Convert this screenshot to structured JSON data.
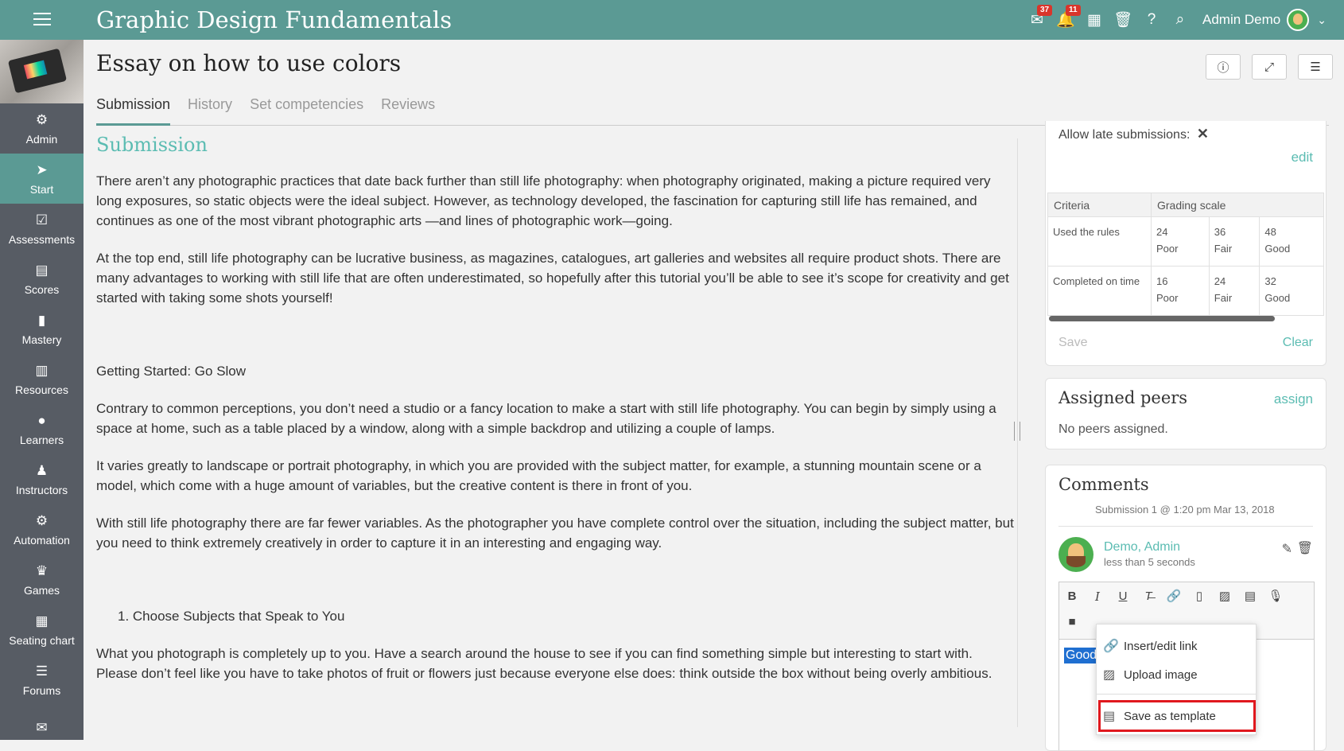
{
  "topbar": {
    "course_title": "Graphic Design Fundamentals",
    "badges": {
      "messages": "37",
      "notifications": "11"
    },
    "user_name": "Admin Demo"
  },
  "sidebar": {
    "items": [
      {
        "label": "Admin",
        "icon": "gear-icon"
      },
      {
        "label": "Start",
        "icon": "navigation-arrow-icon"
      },
      {
        "label": "Assessments",
        "icon": "check-square-icon"
      },
      {
        "label": "Scores",
        "icon": "table-icon"
      },
      {
        "label": "Mastery",
        "icon": "bar-chart-icon"
      },
      {
        "label": "Resources",
        "icon": "books-icon"
      },
      {
        "label": "Learners",
        "icon": "person-icon"
      },
      {
        "label": "Instructors",
        "icon": "instructor-icon"
      },
      {
        "label": "Automation",
        "icon": "gears-icon"
      },
      {
        "label": "Games",
        "icon": "trophy-icon"
      },
      {
        "label": "Seating chart",
        "icon": "seating-grid-icon"
      },
      {
        "label": "Forums",
        "icon": "list-icon"
      }
    ]
  },
  "page": {
    "title": "Essay on how to use colors",
    "tabs": [
      "Submission",
      "History",
      "Set competencies",
      "Reviews"
    ]
  },
  "submission": {
    "heading": "Submission",
    "para1": "There aren’t any photographic practices that date back further than still life photography: when photography originated, making a picture required very long exposures, so static objects were the ideal subject. However, as technology developed, the fascination for capturing still life has remained, and continues as one of the most vibrant photographic arts —and lines of photographic work—going.",
    "para2": "At the top end, still life photography can be lucrative business, as magazines, catalogues, art galleries and websites all require product shots. There are many advantages to working with still life that are often underestimated, so hopefully after this tutorial you’ll be able to see it’s scope for creativity and get started with taking some shots yourself!",
    "subheading": "Getting Started: Go Slow",
    "para3": "Contrary to common perceptions, you don’t need a studio or a fancy location to make a start with still life photography. You can begin by simply using a space at home, such as a table placed by a window, along with a simple backdrop and utilizing a couple of lamps.",
    "para4": "It varies greatly to landscape or portrait photography, in which you are provided with the subject matter, for example, a stunning mountain scene or a model, which come with a huge amount of variables, but the creative content is there in front of you.",
    "para5": "With still life photography there are far fewer variables. As the photographer you have complete control over the situation, including the subject matter, but you need to think extremely creatively in order to capture it in an interesting and engaging way.",
    "list_item": "1. Choose Subjects that Speak to You",
    "para6": "What you photograph is completely up to you. Have a search around the house to see if you can find something simple but interesting to start with. Please don’t feel like you have to take photos of fruit or flowers just because everyone else does: think outside the box without being overly ambitious."
  },
  "grading": {
    "late_label": "Allow late submissions:",
    "late_value": "✕",
    "edit": "edit",
    "headers": [
      "Criteria",
      "Grading scale"
    ],
    "rows": [
      {
        "criteria": "Used the rules",
        "levels": [
          [
            "24",
            "Poor"
          ],
          [
            "36",
            "Fair"
          ],
          [
            "48",
            "Good"
          ]
        ]
      },
      {
        "criteria": "Completed on time",
        "levels": [
          [
            "16",
            "Poor"
          ],
          [
            "24",
            "Fair"
          ],
          [
            "32",
            "Good"
          ]
        ]
      }
    ],
    "save": "Save",
    "clear": "Clear"
  },
  "peers": {
    "title": "Assigned peers",
    "assign": "assign",
    "empty": "No peers assigned."
  },
  "comments": {
    "title": "Comments",
    "submission_info": "Submission 1 @ 1:20 pm Mar 13, 2018",
    "author": "Demo, Admin",
    "time": "less than 5 seconds",
    "editor_text": "Good"
  },
  "context_menu": {
    "items": [
      "Insert/edit link",
      "Upload image",
      "Save as template"
    ]
  },
  "colors": {
    "topbar": "#5b9a94",
    "sidebar": "#575c64",
    "accent": "#5bbcb2",
    "highlight_box": "#e0181e"
  }
}
